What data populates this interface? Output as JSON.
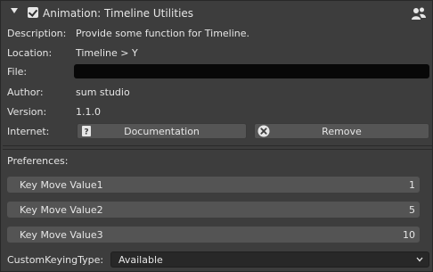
{
  "header": {
    "title": "Animation: Timeline Utilities",
    "enabled": true
  },
  "info": {
    "description_label": "Description:",
    "description_value": "Provide some function for Timeline.",
    "location_label": "Location:",
    "location_value": "Timeline > Y",
    "file_label": "File:",
    "file_value": "",
    "author_label": "Author:",
    "author_value": "sum studio",
    "version_label": "Version:",
    "version_value": "1.1.0",
    "internet_label": "Internet:"
  },
  "buttons": {
    "documentation_label": "Documentation",
    "remove_label": "Remove"
  },
  "preferences": {
    "heading": "Preferences:",
    "fields": [
      {
        "label": "Key Move Value1",
        "value": "1"
      },
      {
        "label": "Key Move Value2",
        "value": "5"
      },
      {
        "label": "Key Move Value3",
        "value": "10"
      }
    ],
    "custom_keying_label": "CustomKeyingType:",
    "custom_keying_value": "Available"
  },
  "colors": {
    "panel_bg": "#3d3d3d",
    "field_bg": "#545454",
    "text": "#e6e6e6"
  }
}
